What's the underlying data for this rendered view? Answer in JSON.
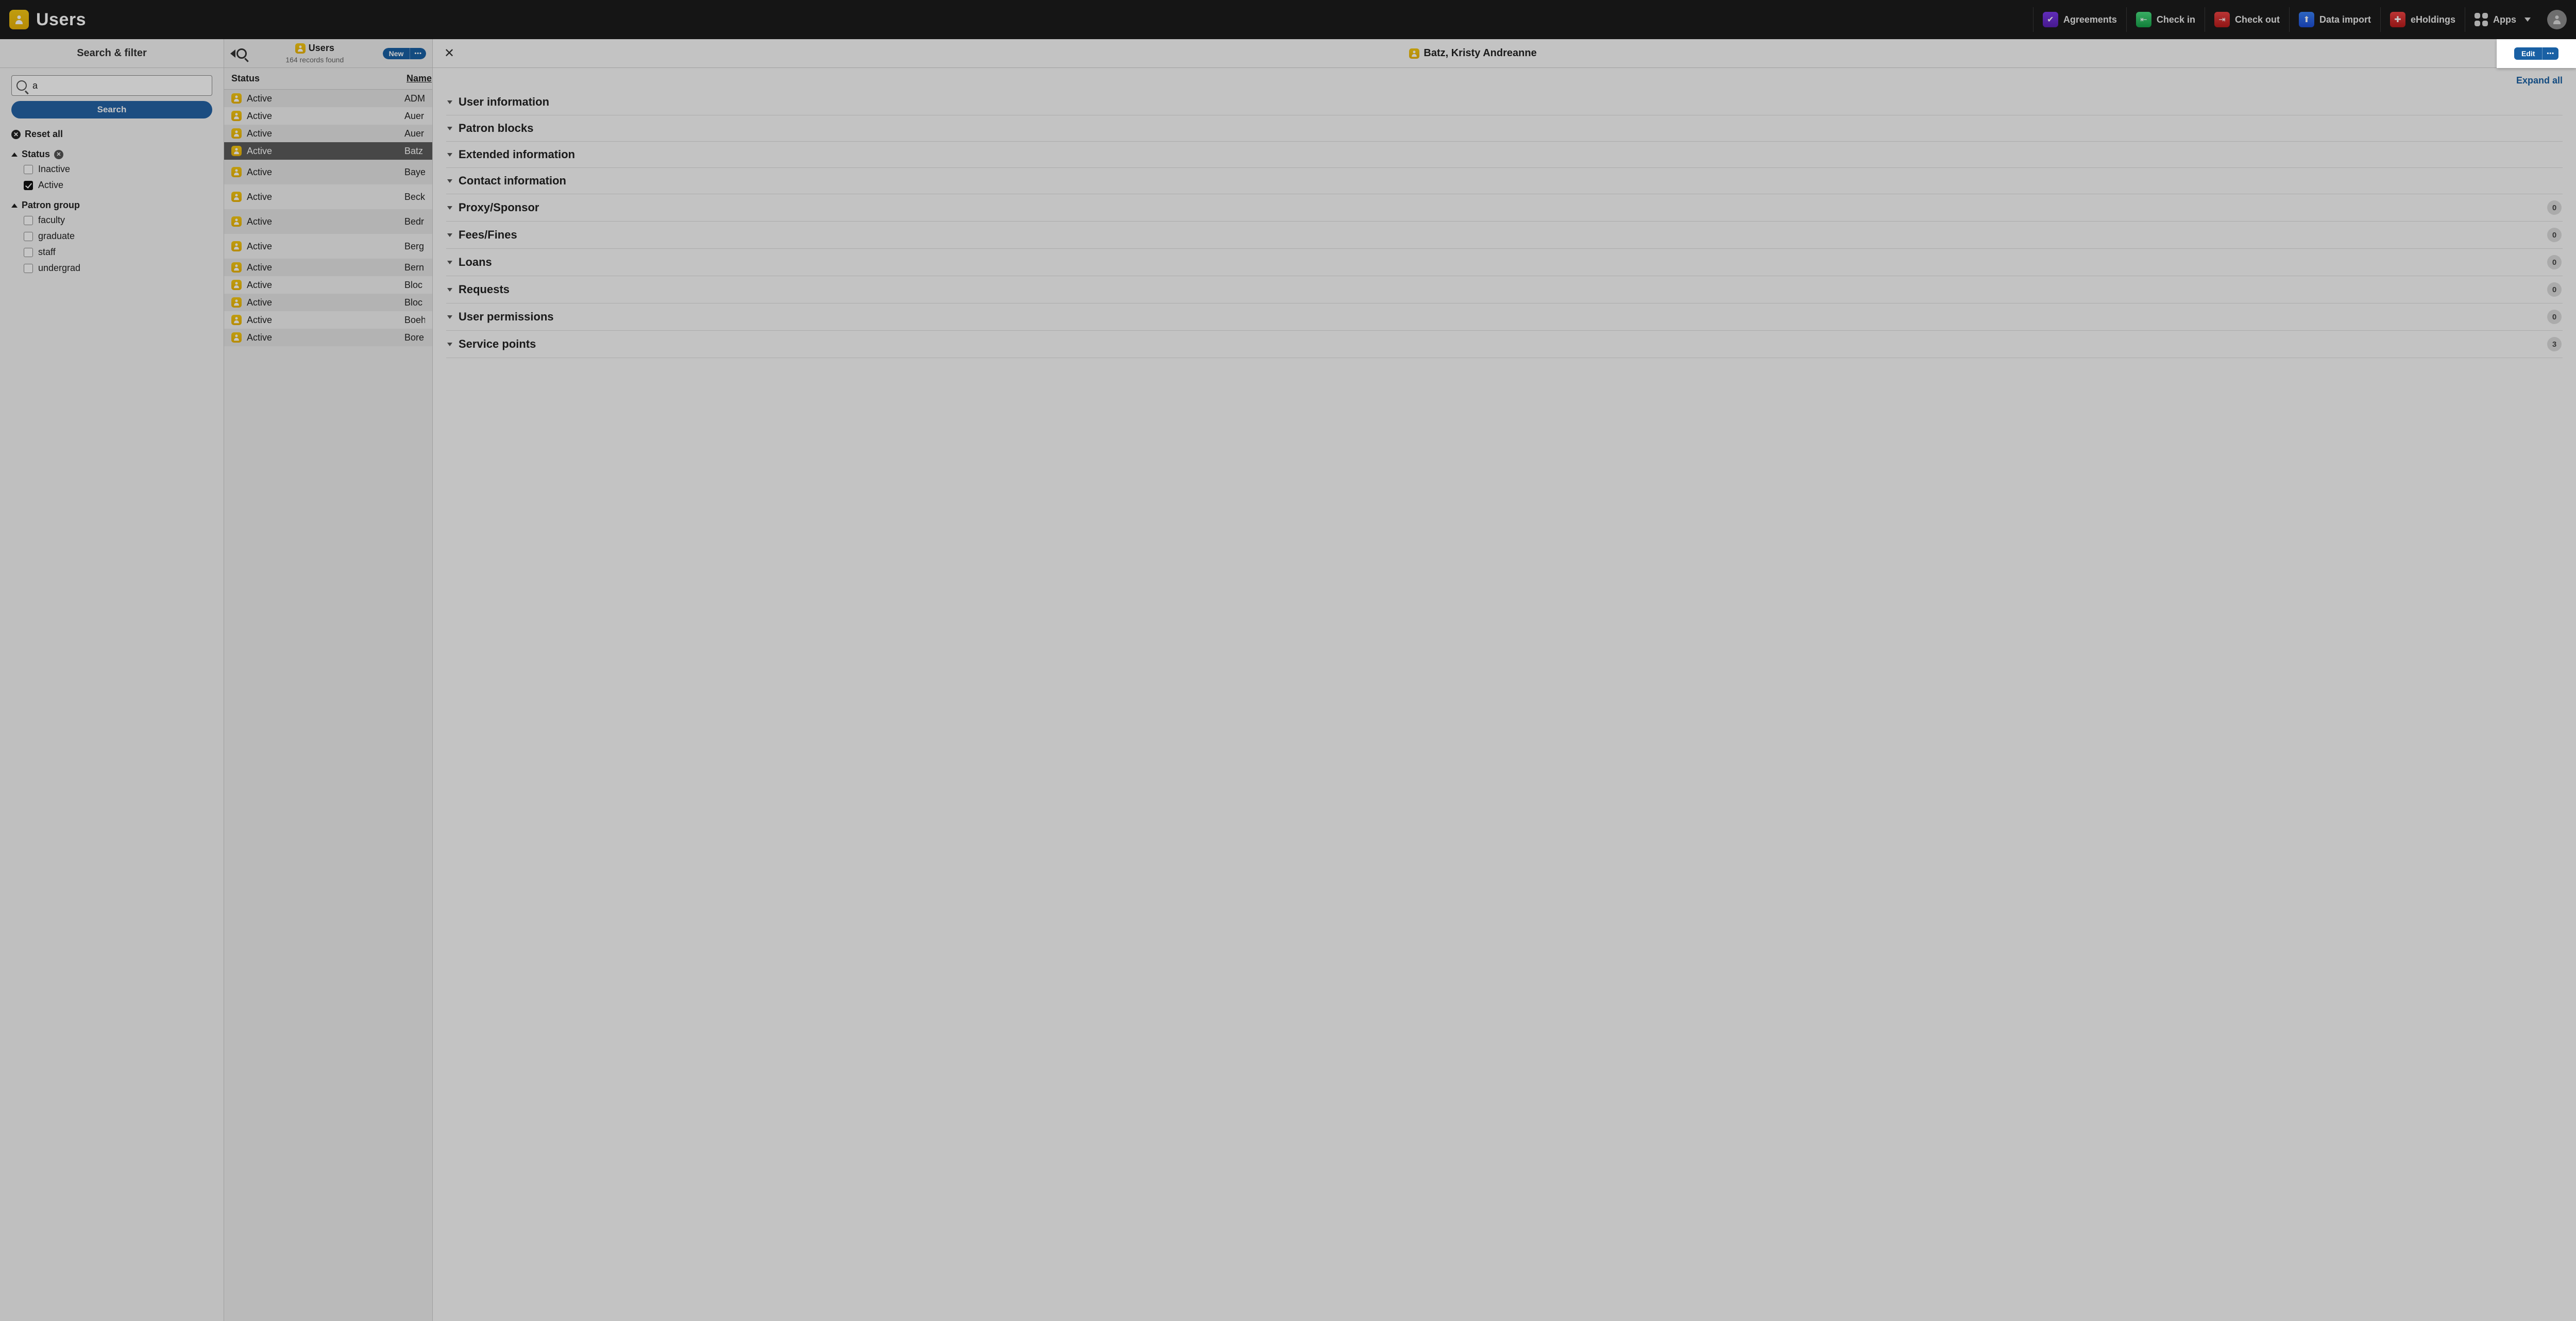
{
  "app": {
    "title": "Users"
  },
  "nav": {
    "agreements": "Agreements",
    "checkin": "Check in",
    "checkout": "Check out",
    "dataimport": "Data import",
    "eholdings": "eHoldings",
    "apps": "Apps"
  },
  "filter": {
    "header": "Search & filter",
    "search_value": "a",
    "search_button": "Search",
    "reset": "Reset all",
    "status": {
      "label": "Status",
      "options": {
        "inactive": "Inactive",
        "active": "Active"
      },
      "checked": {
        "inactive": false,
        "active": true
      }
    },
    "patron_group": {
      "label": "Patron group",
      "options": {
        "faculty": "faculty",
        "graduate": "graduate",
        "staff": "staff",
        "undergrad": "undergrad"
      }
    }
  },
  "results": {
    "title": "Users",
    "subtitle": "164 records found",
    "new_label": "New",
    "col_status": "Status",
    "col_name": "Name",
    "rows": [
      {
        "status": "Active",
        "name": "ADM",
        "selected": false,
        "tall": false
      },
      {
        "status": "Active",
        "name": "Auer",
        "selected": false,
        "tall": false
      },
      {
        "status": "Active",
        "name": "Auer",
        "selected": false,
        "tall": false
      },
      {
        "status": "Active",
        "name": "Batz",
        "selected": true,
        "tall": false
      },
      {
        "status": "Active",
        "name": "Baye",
        "selected": false,
        "tall": true
      },
      {
        "status": "Active",
        "name": "Beck",
        "selected": false,
        "tall": true
      },
      {
        "status": "Active",
        "name": "Bedr",
        "selected": false,
        "tall": true
      },
      {
        "status": "Active",
        "name": "Berg",
        "selected": false,
        "tall": true
      },
      {
        "status": "Active",
        "name": "Bern",
        "selected": false,
        "tall": false
      },
      {
        "status": "Active",
        "name": "Bloc",
        "selected": false,
        "tall": false
      },
      {
        "status": "Active",
        "name": "Bloc",
        "selected": false,
        "tall": false
      },
      {
        "status": "Active",
        "name": "Boeh",
        "selected": false,
        "tall": false
      },
      {
        "status": "Active",
        "name": "Bore",
        "selected": false,
        "tall": false
      }
    ]
  },
  "detail": {
    "title": "Batz, Kristy Andreanne",
    "edit_label": "Edit",
    "expand_all": "Expand all",
    "sections": [
      {
        "title": "User information",
        "count": null
      },
      {
        "title": "Patron blocks",
        "count": null
      },
      {
        "title": "Extended information",
        "count": null
      },
      {
        "title": "Contact information",
        "count": null
      },
      {
        "title": "Proxy/Sponsor",
        "count": "0"
      },
      {
        "title": "Fees/Fines",
        "count": "0"
      },
      {
        "title": "Loans",
        "count": "0"
      },
      {
        "title": "Requests",
        "count": "0"
      },
      {
        "title": "User permissions",
        "count": "0"
      },
      {
        "title": "Service points",
        "count": "3"
      }
    ]
  }
}
